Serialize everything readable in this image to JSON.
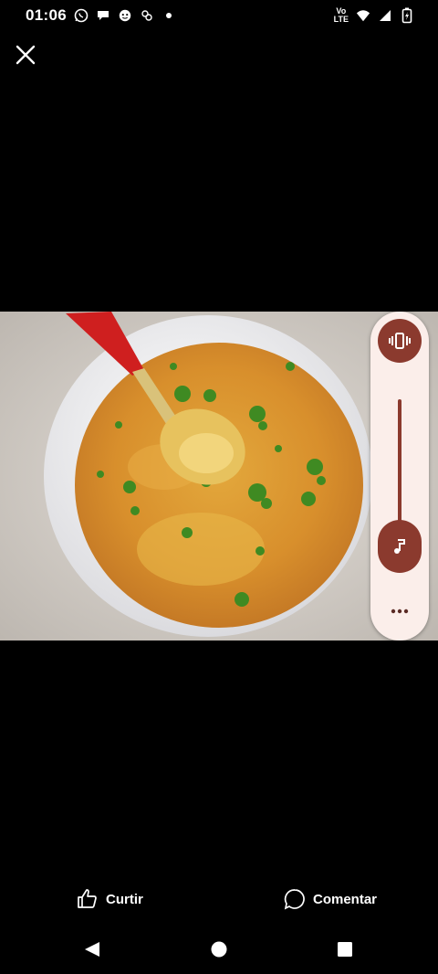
{
  "status_bar": {
    "time": "01:06",
    "network_label_top": "Vo",
    "network_label_bottom": "LTE",
    "icons": [
      "whatsapp-icon",
      "chat-bubble-icon",
      "messenger-icon",
      "app-notification-icon",
      "dot-icon",
      "wifi-icon",
      "signal-icon",
      "battery-charging-icon"
    ]
  },
  "viewer": {
    "close_icon": "close-icon",
    "photo_description_icon": "image-icon"
  },
  "volume_panel": {
    "mode_icon": "vibrate-icon",
    "stream_icon": "music-note-icon",
    "more_icon": "more-dots-icon",
    "level": 0.16,
    "accent_color": "#8b3a2e",
    "panel_color": "#fbeeea"
  },
  "actions": {
    "like_label": "Curtir",
    "comment_label": "Comentar"
  },
  "nav": {
    "back_icon": "back-triangle-icon",
    "home_icon": "home-circle-icon",
    "recents_icon": "recents-square-icon"
  }
}
